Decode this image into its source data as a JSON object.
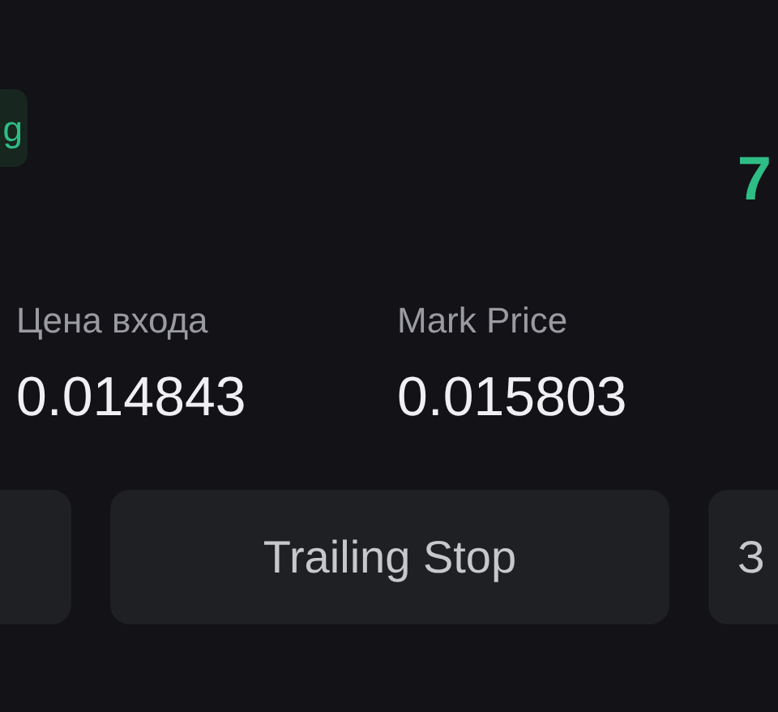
{
  "badge": {
    "label": "g"
  },
  "pnl": {
    "value": "7"
  },
  "stats": [
    {
      "label": "Цена входа",
      "value": "0.014843"
    },
    {
      "label": "Mark Price",
      "value": "0.015803"
    }
  ],
  "buttons": [
    {
      "kind": "partial"
    },
    {
      "label": "Trailing Stop",
      "kind": "full"
    },
    {
      "label": "З",
      "kind": "partial"
    }
  ]
}
